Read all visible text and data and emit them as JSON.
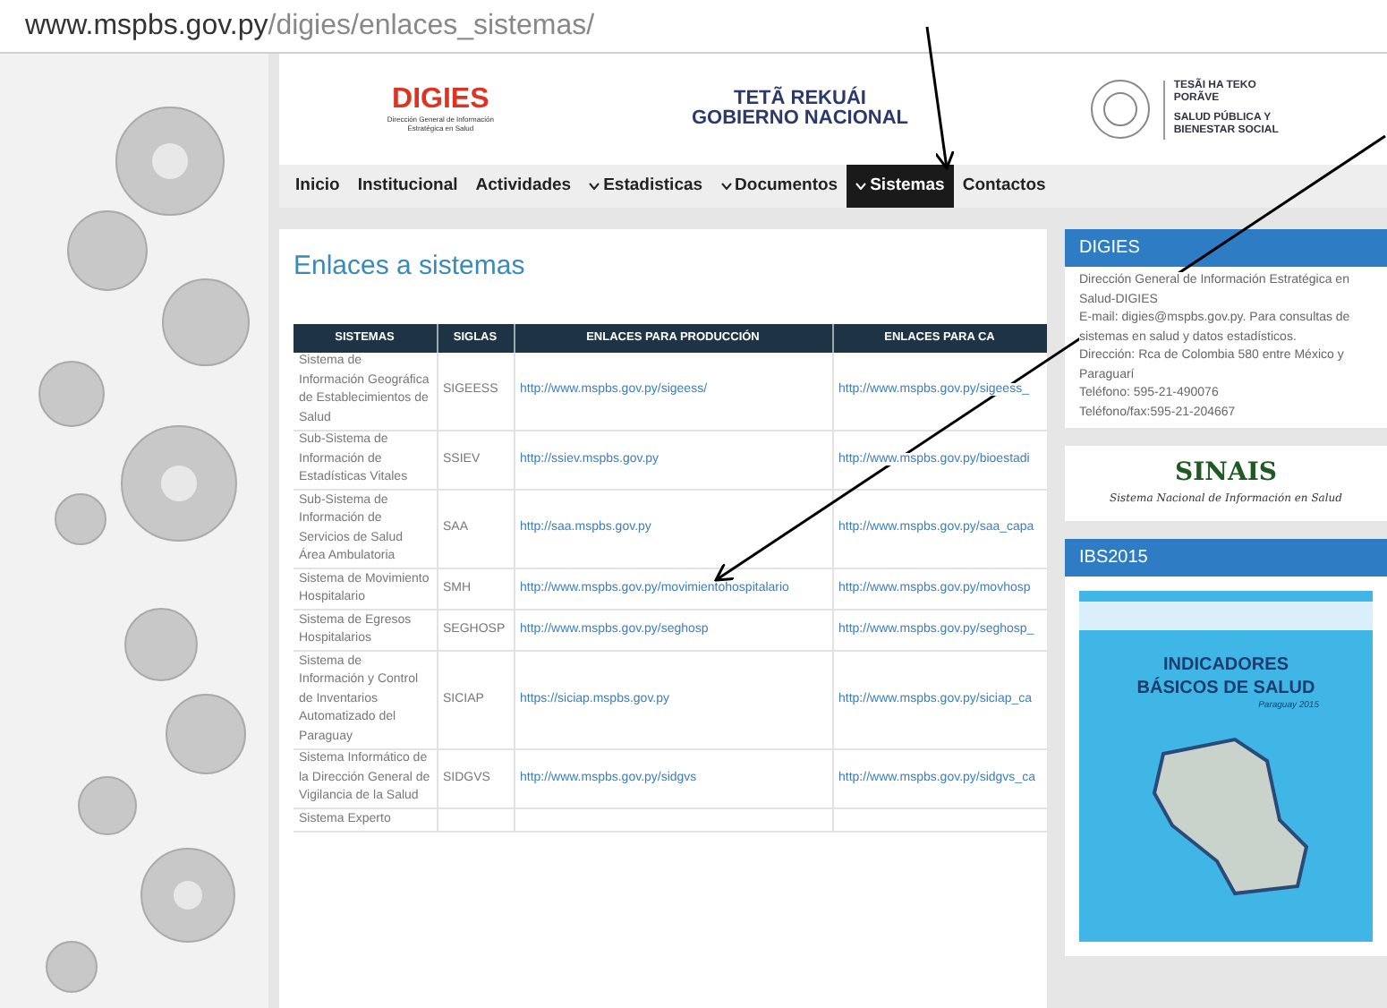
{
  "address_bar": {
    "host": "www.mspbs.gov.py",
    "path": "/digies/enlaces_sistemas/"
  },
  "header": {
    "digies_logo": {
      "name": "DIGIES",
      "subtitle": "Dirección General de Información Estratégica en Salud"
    },
    "gov_logo": {
      "line_1": "TETÃ REKUÁI",
      "line_2": "GOBIERNO NACIONAL"
    },
    "ministry_logo": {
      "line_1": "TESÃI HA TEKO PORÃVE",
      "line_2": "SALUD PÚBLICA Y BIENESTAR SOCIAL"
    }
  },
  "nav": [
    {
      "label": "Inicio",
      "kind": "link",
      "selected": false
    },
    {
      "label": "Institucional",
      "kind": "link",
      "selected": false
    },
    {
      "label": "Actividades",
      "kind": "link",
      "selected": false
    },
    {
      "label": "Estadisticas",
      "kind": "dropdown",
      "selected": false
    },
    {
      "label": "Documentos",
      "kind": "dropdown",
      "selected": false
    },
    {
      "label": "Sistemas",
      "kind": "dropdown",
      "selected": true
    },
    {
      "label": "Contactos",
      "kind": "link",
      "selected": false
    }
  ],
  "content": {
    "title": "Enlaces a sistemas",
    "table": {
      "columns": [
        "SISTEMAS",
        "SIGLAS",
        "ENLACES PARA PRODUCCIÓN",
        "ENLACES PARA CA"
      ],
      "rows": [
        [
          "Sistema de Información Geográfica de Establecimientos de Salud",
          "SIGEESS",
          "http://www.mspbs.gov.py/sigeess/",
          "http://www.mspbs.gov.py/sigeess_"
        ],
        [
          "Sub-Sistema de Información de Estadísticas Vitales",
          "SSIEV",
          "http://ssiev.mspbs.gov.py",
          "http://www.mspbs.gov.py/bioestadi"
        ],
        [
          "Sub-Sistema de Información de Servicios de Salud Área Ambulatoria",
          "SAA",
          "http://saa.mspbs.gov.py",
          "http://www.mspbs.gov.py/saa_capa"
        ],
        [
          "Sistema de Movimiento Hospitalario",
          "SMH",
          "http://www.mspbs.gov.py/movimientohospitalario",
          "http://www.mspbs.gov.py/movhosp"
        ],
        [
          "Sistema de Egresos Hospitalarios",
          "SEGHOSP",
          "http://www.mspbs.gov.py/seghosp",
          "http://www.mspbs.gov.py/seghosp_"
        ],
        [
          "Sistema de Información y Control de Inventarios Automatizado del Paraguay",
          "SICIAP",
          "https://siciap.mspbs.gov.py",
          "http://www.mspbs.gov.py/siciap_ca"
        ],
        [
          "Sistema Informático de la Dirección General de Vigilancia de la Salud",
          "SIDGVS",
          "http://www.mspbs.gov.py/sidgvs",
          "http://www.mspbs.gov.py/sidgvs_ca"
        ],
        [
          "Sistema Experto",
          "",
          "",
          ""
        ]
      ]
    }
  },
  "sidebar": [
    {
      "kind": "text",
      "title": "DIGIES",
      "lines": [
        "Dirección General de Información Estratégica en Salud-DIGIES",
        "E-mail: digies@mspbs.gov.py. Para consultas de sistemas en salud y datos estadísticos.",
        "Dirección: Rca de Colombia 580 entre México y Paraguarí",
        "Teléfono: 595-21-490076",
        "Teléfono/fax:595-21-204667"
      ]
    },
    {
      "kind": "banner",
      "name": "SINAIS",
      "subtitle": "Sistema Nacional de Información en Salud"
    },
    {
      "kind": "cover",
      "title": "IBS2015",
      "cover_title_1": "INDICADORES",
      "cover_title_2": "BÁSICOS DE SALUD",
      "cover_subtitle": "Paraguay 2015"
    }
  ]
}
